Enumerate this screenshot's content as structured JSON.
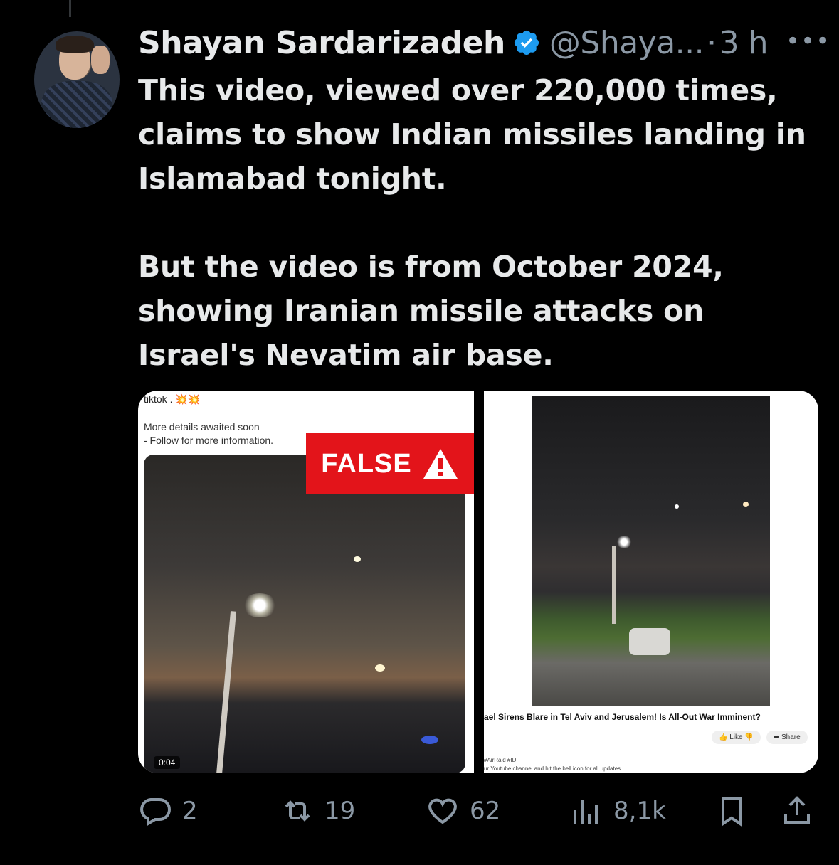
{
  "author": {
    "name": "Shayan Sardarizadeh",
    "handle": "@Shaya...",
    "separator": "·",
    "time": "3 h",
    "more_label": "•••"
  },
  "tweet": {
    "paragraph1": "This video, viewed over 220,000 times, claims to show Indian missiles landing in Islamabad tonight.",
    "paragraph2": "But the video is from October 2024, showing Iranian missile attacks on Israel's Nevatim air base."
  },
  "media": {
    "left": {
      "source_text": "tiktok . 💥💥",
      "details_line1": "More details awaited soon",
      "details_line2": "- Follow for more information.",
      "badge_text": "FALSE",
      "duration": "0:04"
    },
    "right": {
      "title": "ael Sirens Blare in Tel Aviv and Jerusalem! Is All-Out War Imminent?",
      "like_label": "Like",
      "share_label": "Share",
      "desc_line1": "#AirRaid #IDF",
      "desc_line2": "ur Youtube channel and hit the bell icon for all updates."
    }
  },
  "actions": {
    "replies": "2",
    "reposts": "19",
    "likes": "62",
    "views": "8,1k"
  },
  "colors": {
    "background": "#000000",
    "text": "#e7e9ea",
    "secondary": "#8b98a5",
    "verified": "#1d9bf0",
    "false_badge": "#e3141a"
  }
}
